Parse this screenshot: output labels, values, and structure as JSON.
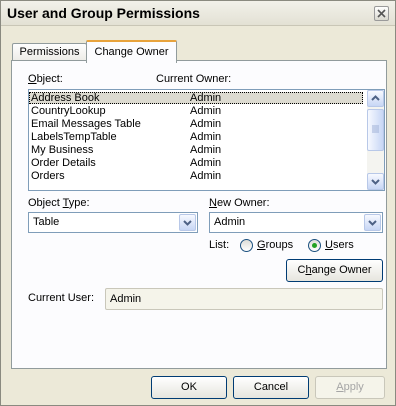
{
  "window": {
    "title": "User and Group Permissions"
  },
  "tabs": [
    {
      "label": "Permissions",
      "active": false
    },
    {
      "label": "Change Owner",
      "active": true
    }
  ],
  "objects_header": {
    "object": "Object:",
    "object_ul": "O",
    "object_rest": "bject:",
    "current_owner": "Current Owner:"
  },
  "objects": [
    {
      "name": "Address Book",
      "owner": "Admin",
      "selected": true
    },
    {
      "name": "CountryLookup",
      "owner": "Admin"
    },
    {
      "name": "Email Messages Table",
      "owner": "Admin"
    },
    {
      "name": "LabelsTempTable",
      "owner": "Admin"
    },
    {
      "name": "My Business",
      "owner": "Admin"
    },
    {
      "name": "Order Details",
      "owner": "Admin"
    },
    {
      "name": "Orders",
      "owner": "Admin"
    }
  ],
  "object_type": {
    "label_pre": "Object ",
    "label_ul": "T",
    "label_post": "ype:",
    "value": "Table"
  },
  "new_owner": {
    "label_ul": "N",
    "label_post": "ew Owner:",
    "value": "Admin"
  },
  "list_filter": {
    "label": "List:",
    "groups": {
      "ul": "G",
      "rest": "roups",
      "checked": false
    },
    "users": {
      "ul": "U",
      "rest": "sers",
      "checked": true
    }
  },
  "change_owner_button": {
    "ul": "h",
    "pre": "C",
    "post": "ange Owner"
  },
  "current_user": {
    "label": "Current User:",
    "value": "Admin"
  },
  "footer": {
    "ok": "OK",
    "cancel": "Cancel",
    "apply_ul": "A",
    "apply_rest": "pply"
  },
  "colors": {
    "accent": "#e8a33c",
    "radio_dot": "#21a121"
  },
  "icons": [
    "close-icon",
    "scroll-up-arrow-icon",
    "scroll-down-arrow-icon",
    "dropdown-arrow-icon",
    "radio-icon"
  ]
}
